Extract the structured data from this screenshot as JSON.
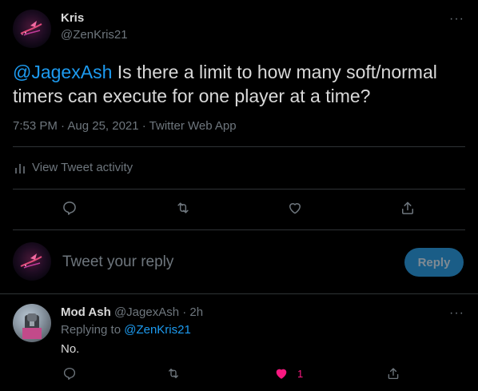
{
  "main_tweet": {
    "author_name": "Kris",
    "author_handle": "@ZenKris21",
    "more_label": "···",
    "mention": "@JagexAsh",
    "text": " Is there a limit to how many soft/normal timers can execute for one player at a time?",
    "timestamp": "7:53 PM · Aug 25, 2021 · Twitter Web App",
    "activity_label": "View Tweet activity",
    "actions": [
      "reply-icon",
      "retweet-icon",
      "like-icon",
      "share-icon"
    ]
  },
  "composer": {
    "placeholder": "Tweet your reply",
    "reply_button": "Reply"
  },
  "reply_tweet": {
    "author_name": "Mod Ash",
    "author_handle": "@JagexAsh",
    "age": "· 2h",
    "more_label": "···",
    "replying_to_label": "Replying to ",
    "replying_to_handle": "@ZenKris21",
    "text": "No.",
    "like_count": "1",
    "actions": [
      "reply-icon",
      "retweet-icon",
      "like-icon",
      "share-icon"
    ]
  },
  "colors": {
    "background": "#000000",
    "text": "#d9d9d9",
    "secondary": "#6e767d",
    "accent": "#1d9bf0",
    "like": "#f91880",
    "divider": "#2f3336"
  }
}
